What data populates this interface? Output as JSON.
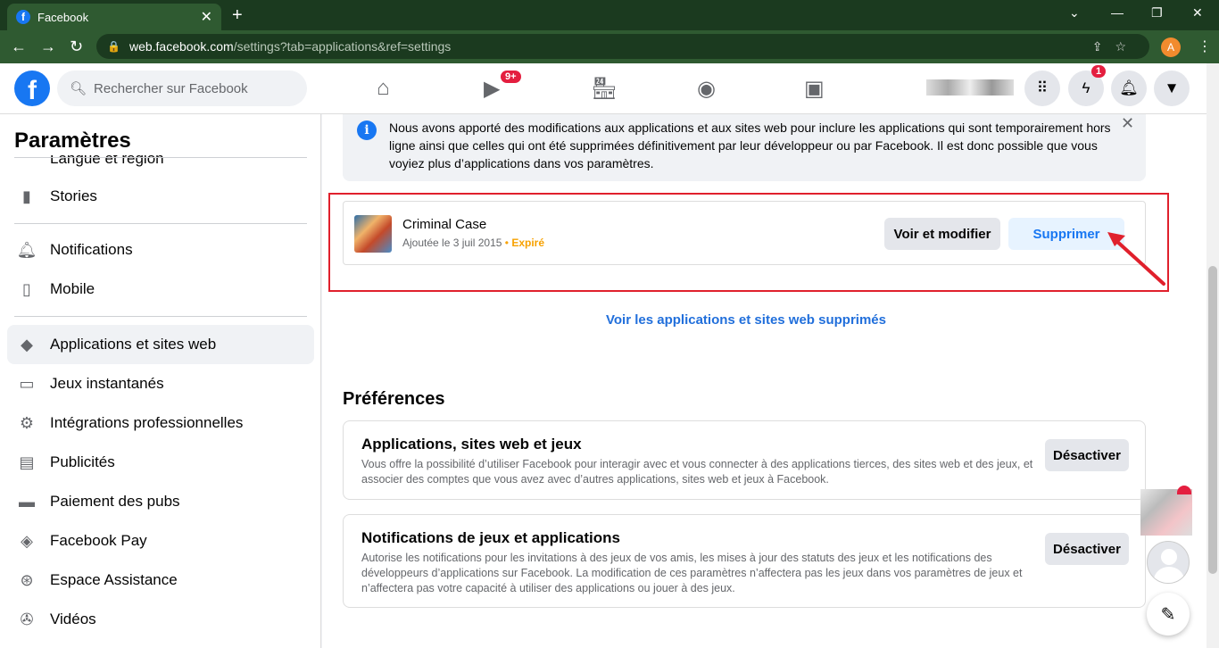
{
  "browser": {
    "tab_title": "Facebook",
    "tab_favicon": "f",
    "url_host": "web.facebook.com",
    "url_path": "/settings?tab=applications&ref=settings",
    "profile_initial": "A"
  },
  "header": {
    "search_placeholder": "Rechercher sur Facebook",
    "watch_badge": "9+",
    "messenger_badge": "1",
    "logo": "f"
  },
  "sidebar": {
    "title": "Paramètres",
    "partial_item": "Langue et région",
    "items": [
      {
        "label": "Stories",
        "icon": "stories-icon"
      },
      {
        "label": "Notifications",
        "icon": "bell-icon"
      },
      {
        "label": "Mobile",
        "icon": "mobile-icon"
      },
      {
        "label": "Applications et sites web",
        "icon": "cube-icon"
      },
      {
        "label": "Jeux instantanés",
        "icon": "gamepad-icon"
      },
      {
        "label": "Intégrations professionnelles",
        "icon": "business-integrations-icon"
      },
      {
        "label": "Publicités",
        "icon": "ads-icon"
      },
      {
        "label": "Paiement des pubs",
        "icon": "card-icon"
      },
      {
        "label": "Facebook Pay",
        "icon": "pay-icon"
      },
      {
        "label": "Espace Assistance",
        "icon": "lifebuoy-icon"
      },
      {
        "label": "Vidéos",
        "icon": "film-icon"
      }
    ]
  },
  "main": {
    "info_text": "Nous avons apporté des modifications aux applications et aux sites web pour inclure les applications qui sont temporairement hors ligne ainsi que celles qui ont été supprimées définitivement par leur développeur ou par Facebook. Il est donc possible que vous voyiez plus d’applications dans vos paramètres.",
    "app": {
      "name": "Criminal Case",
      "added": "Ajoutée le 3 juil 2015",
      "separator": "•",
      "status": "Expiré",
      "edit_label": "Voir et modifier",
      "remove_label": "Supprimer"
    },
    "removed_link": "Voir les applications et sites web supprimés",
    "preferences_title": "Préférences",
    "preferences": [
      {
        "title": "Applications, sites web et jeux",
        "description": "Vous offre la possibilité d’utiliser Facebook pour interagir avec et vous connecter à des applications tierces, des sites web et des jeux, et associer des comptes que vous avez avec d’autres applications, sites web et jeux à Facebook.",
        "button": "Désactiver"
      },
      {
        "title": "Notifications de jeux et applications",
        "description": "Autorise les notifications pour les invitations à des jeux de vos amis, les mises à jour des statuts des jeux et les notifications des développeurs d’applications sur Facebook. La modification de ces paramètres n’affectera pas les jeux dans vos paramètres de jeux et n’affectera pas votre capacité à utiliser des applications ou jouer à des jeux.",
        "button": "Désactiver"
      }
    ]
  },
  "colors": {
    "facebook_blue": "#1877f2",
    "highlight_red": "#e0202c",
    "expired_orange": "#f7a100",
    "browser_green": "#2f5a31"
  }
}
